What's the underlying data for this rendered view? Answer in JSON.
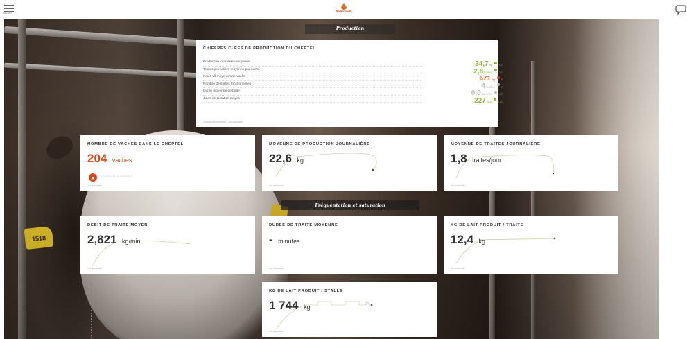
{
  "header": {
    "menu_label": "MENU",
    "logo_text": "Robotmilk",
    "menu_icon": "hamburger-icon",
    "chat_icon": "chat-bubble-icon"
  },
  "sections": {
    "production": "Production",
    "frequentation": "Fréquentation et saturation"
  },
  "key_figures": {
    "title": "CHIFFRES CLEFS DE PRODUCTION DU CHEPTEL",
    "rows": [
      {
        "label": "Production journalière moyenne",
        "value": "34,7",
        "unit": "kg",
        "delta": "1,3",
        "color": "#8fb43a"
      },
      {
        "label": "Traites journalière moyenne par vache",
        "value": "2,8",
        "unit": "traites",
        "delta": "0,2",
        "color": "#8fb43a"
      },
      {
        "label": "Poids vif moyen d'une vache",
        "value": "671",
        "unit": "kg",
        "delta": "5",
        "color": "#d9481c"
      },
      {
        "label": "Nombre de stalles fonctionnelles",
        "value": "4",
        "unit": "stalles",
        "delta": "0",
        "color": "#bbbbbb"
      },
      {
        "label": "Durée moyenne de traite",
        "value": "0,0",
        "unit": "minutes",
        "delta": "0,0",
        "color": "#bbbbbb"
      },
      {
        "label": "Jours de lactation moyen",
        "value": "227",
        "unit": "jour",
        "delta": "121",
        "color": "#8fb43a"
      }
    ],
    "source": "Source des données : 1re automate"
  },
  "cards": {
    "vaches": {
      "title": "NOMBRE DE VACHES DANS LE CHEPTEL",
      "value": "204",
      "unit": "vaches",
      "alert": "1 vache(s) en alerte(s)",
      "source": "1re automate"
    },
    "prod_jour": {
      "title": "MOYENNE DE PRODUCTION JOURNALIÈRE",
      "value": "22,6",
      "unit": "kg",
      "source": "1re automate"
    },
    "traites_jour": {
      "title": "MOYENNE DE TRAITES JOURNALIÈRE",
      "value": "1,8",
      "unit": "traites/jour",
      "source": "1re automate"
    },
    "debit": {
      "title": "DÉBIT DE TRAITE MOYEN",
      "value": "2,821",
      "unit": "kg/min",
      "source": "1re automate"
    },
    "duree": {
      "title": "DURÉE DE TRAITE MOYENNE",
      "value": "-",
      "unit": "minutes",
      "source": "1re automate"
    },
    "kg_traite": {
      "title": "KG DE LAIT PRODUIT / TRAITE",
      "value": "12,4",
      "unit": "kg",
      "source": "1re automate"
    },
    "kg_stalle": {
      "title": "KG DE LAIT PRODUIT / STALLE",
      "value": "1 744",
      "unit": "kg",
      "source": "1re automate"
    }
  },
  "background": {
    "ear_tag": "1518"
  },
  "colors": {
    "accent_orange": "#d9481c",
    "accent_green": "#8fb43a",
    "spark_line": "#c8d5a8"
  }
}
